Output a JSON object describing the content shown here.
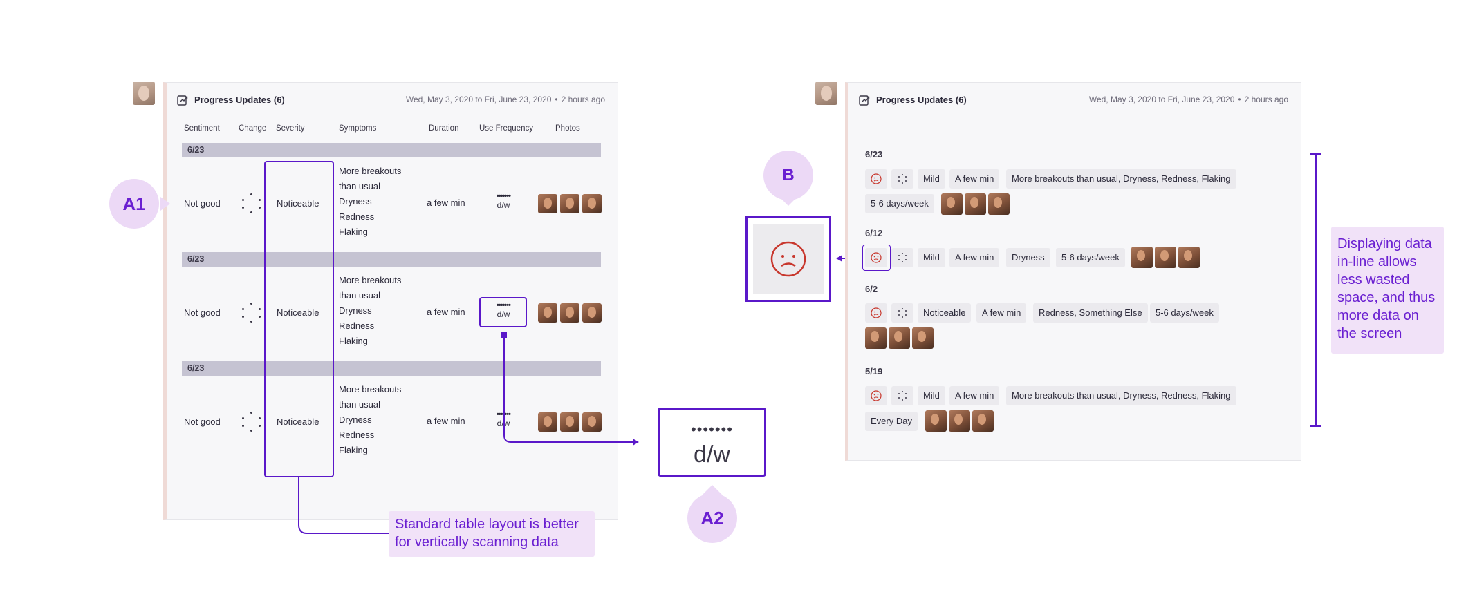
{
  "colors": {
    "accent": "#5a18c9",
    "callout_bg": "#ecd9f6",
    "note_bg": "#f1e2f8",
    "date_bar": "#c5c3d2",
    "sad_face": "#c8372d"
  },
  "left_card": {
    "title": "Progress Updates (6)",
    "dates": "Wed, May 3, 2020 to Fri, June 23, 2020",
    "ago": "2 hours ago",
    "columns": [
      "Sentiment",
      "Change",
      "Severity",
      "Symptoms",
      "Duration",
      "Use Frequency",
      "Photos"
    ],
    "rows": [
      {
        "date": "6/23",
        "sentiment": "Not good",
        "severity": "Noticeable",
        "symptoms": [
          "More breakouts",
          "than usual",
          "Dryness",
          "Redness",
          "Flaking"
        ],
        "duration": "a few min",
        "freq_dots": "•••••••",
        "freq_unit": "d/w"
      },
      {
        "date": "6/23",
        "sentiment": "Not good",
        "severity": "Noticeable",
        "symptoms": [
          "More breakouts",
          "than usual",
          "Dryness",
          "Redness",
          "Flaking"
        ],
        "duration": "a few min",
        "freq_dots": "•••••••",
        "freq_unit": "d/w"
      },
      {
        "date": "6/23",
        "sentiment": "Not good",
        "severity": "Noticeable",
        "symptoms": [
          "More breakouts",
          "than usual",
          "Dryness",
          "Redness",
          "Flaking"
        ],
        "duration": "a few min",
        "freq_dots": "•••••••",
        "freq_unit": "d/w"
      }
    ]
  },
  "right_card": {
    "title": "Progress Updates (6)",
    "dates": "Wed, May 3, 2020 to Fri, June 23, 2020",
    "ago": "2 hours ago",
    "entries": [
      {
        "date": "6/23",
        "severity": "Mild",
        "duration": "A few min",
        "symptoms": "More breakouts than usual, Dryness, Redness, Flaking",
        "frequency": "5-6 days/week"
      },
      {
        "date": "6/12",
        "severity": "Mild",
        "duration": "A few min",
        "symptoms": "Dryness",
        "frequency": "5-6 days/week"
      },
      {
        "date": "6/2",
        "severity": "Noticeable",
        "duration": "A few min",
        "symptoms": "Redness, Something Else",
        "frequency": "5-6 days/week"
      },
      {
        "date": "5/19",
        "severity": "Mild",
        "duration": "A few min",
        "symptoms": "More breakouts than usual, Dryness, Redness, Flaking",
        "frequency": "Every Day"
      }
    ]
  },
  "callouts": {
    "a1": "A1",
    "a2": "A2",
    "b": "B",
    "table_note": "Standard table layout is better for vertically scanning data",
    "inline_note": "Displaying data in-line allows less wasted space, and thus more data on the screen"
  },
  "zoom": {
    "freq_dots": "•••••••",
    "freq_unit": "d/w"
  }
}
